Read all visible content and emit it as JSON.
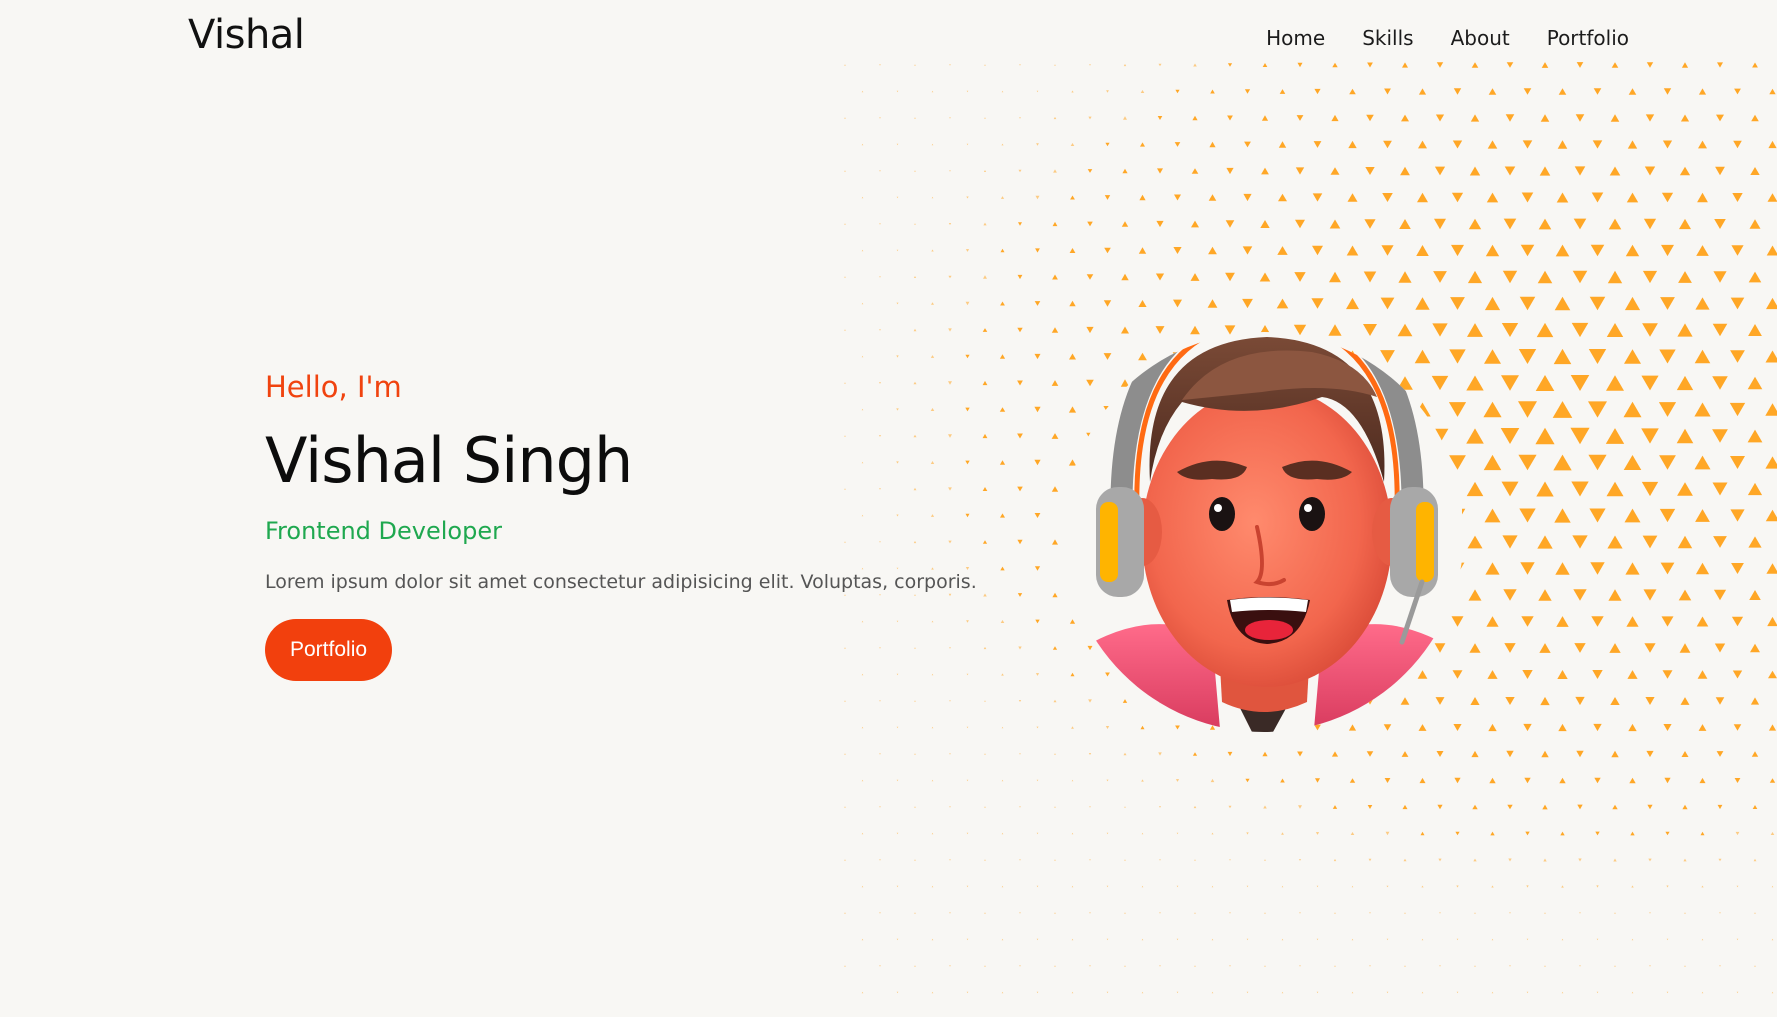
{
  "header": {
    "brand": "Vishal",
    "nav": [
      {
        "label": "Home"
      },
      {
        "label": "Skills"
      },
      {
        "label": "About"
      },
      {
        "label": "Portfolio"
      }
    ]
  },
  "hero": {
    "greeting": "Hello, I'm",
    "name": "Vishal Singh",
    "role": "Frontend Developer",
    "description": "Lorem ipsum dolor sit amet consectetur adipisicing elit. Voluptas, corporis.",
    "button_label": "Portfolio"
  },
  "colors": {
    "background": "#f8f7f4",
    "accent": "#f2400d",
    "role": "#1fa84f",
    "pattern": "#ffa726"
  },
  "icons": {
    "avatar": "avatar-illustration",
    "pattern": "triangle-pattern"
  }
}
